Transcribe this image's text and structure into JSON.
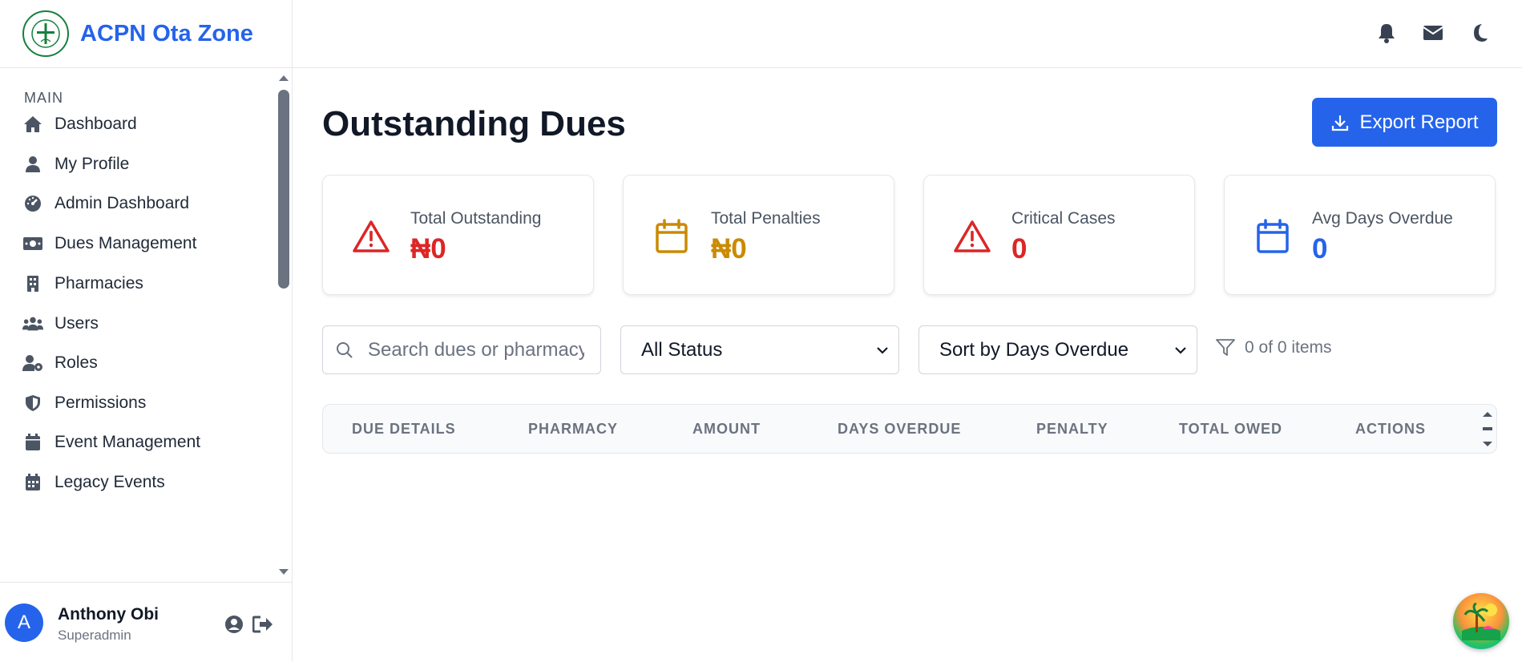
{
  "brand": {
    "name": "ACPN Ota Zone"
  },
  "sidebar": {
    "section_label": "MAIN",
    "items": [
      {
        "label": "Dashboard",
        "icon": "home-icon"
      },
      {
        "label": "My Profile",
        "icon": "user-icon"
      },
      {
        "label": "Admin Dashboard",
        "icon": "gauge-icon"
      },
      {
        "label": "Dues Management",
        "icon": "money-bill-icon"
      },
      {
        "label": "Pharmacies",
        "icon": "building-icon"
      },
      {
        "label": "Users",
        "icon": "users-icon"
      },
      {
        "label": "Roles",
        "icon": "user-gear-icon"
      },
      {
        "label": "Permissions",
        "icon": "shield-icon"
      },
      {
        "label": "Event Management",
        "icon": "calendar-icon"
      },
      {
        "label": "Legacy Events",
        "icon": "calendar-days-icon"
      }
    ]
  },
  "user": {
    "initial": "A",
    "name": "Anthony Obi",
    "role": "Superadmin"
  },
  "topbar": {
    "icons": [
      "bell-icon",
      "envelope-icon",
      "moon-icon"
    ]
  },
  "page": {
    "title": "Outstanding Dues",
    "export_label": "Export Report"
  },
  "stats": [
    {
      "label": "Total Outstanding",
      "value": "₦0",
      "color": "#dc2626",
      "icon": "warning-icon"
    },
    {
      "label": "Total Penalties",
      "value": "₦0",
      "color": "#ca8a04",
      "icon": "calendar-icon"
    },
    {
      "label": "Critical Cases",
      "value": "0",
      "color": "#dc2626",
      "icon": "warning-icon"
    },
    {
      "label": "Avg Days Overdue",
      "value": "0",
      "color": "#2563eb",
      "icon": "calendar-icon"
    }
  ],
  "filters": {
    "search_placeholder": "Search dues or pharmacy",
    "status_value": "All Status",
    "sort_value": "Sort by Days Overdue",
    "count_text": "0 of 0 items"
  },
  "table": {
    "columns": [
      "DUE DETAILS",
      "PHARMACY",
      "AMOUNT",
      "DAYS OVERDUE",
      "PENALTY",
      "TOTAL OWED",
      "ACTIONS"
    ]
  },
  "colors": {
    "accent": "#2563eb",
    "danger": "#dc2626",
    "warning": "#ca8a04",
    "muted": "#6b7280"
  }
}
